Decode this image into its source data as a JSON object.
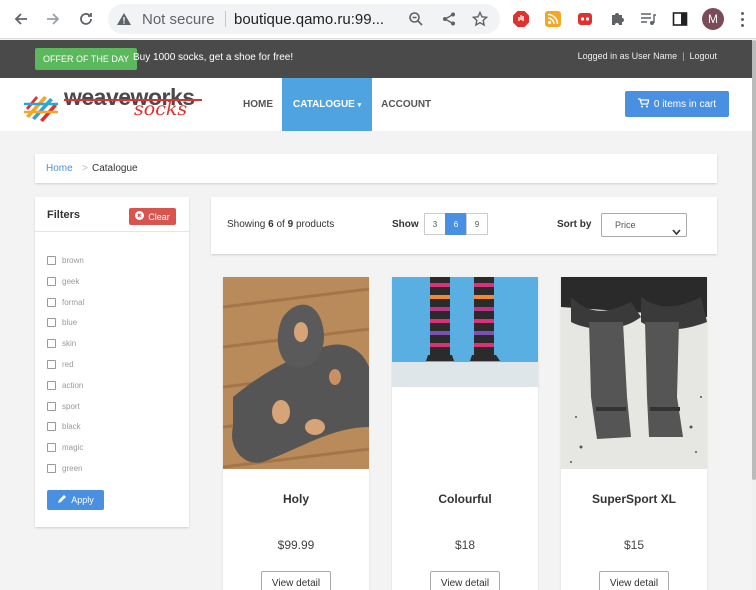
{
  "browser": {
    "security_label": "Not secure",
    "url": "boutique.qamo.ru:99...",
    "profile_initial": "M"
  },
  "topbar": {
    "offer_badge": "OFFER OF THE DAY",
    "offer_text": "Buy 1000 socks, get a shoe for free!",
    "logged_in": "Logged in as User Name",
    "logout": "Logout"
  },
  "header": {
    "logo_main": "weaveworks",
    "logo_sub": "socks",
    "nav": [
      "HOME",
      "CATALOGUE",
      "ACCOUNT"
    ],
    "cart_label": "0 items in cart"
  },
  "breadcrumb": {
    "home": "Home",
    "separator": ">",
    "current": "Catalogue"
  },
  "filters": {
    "title": "Filters",
    "clear_label": "Clear",
    "items": [
      "brown",
      "geek",
      "formal",
      "blue",
      "skin",
      "red",
      "action",
      "sport",
      "black",
      "magic",
      "green"
    ],
    "apply_label": "Apply"
  },
  "toolbar": {
    "showing_prefix": "Showing",
    "showing_count": "6",
    "showing_of": "of",
    "showing_total": "9",
    "showing_suffix": "products",
    "show_label": "Show",
    "page_sizes": [
      "3",
      "6",
      "9"
    ],
    "active_page_size": "6",
    "sort_label": "Sort by",
    "sort_value": "Price"
  },
  "products": [
    {
      "name": "Holy",
      "price": "$99.99",
      "button": "View detail"
    },
    {
      "name": "Colourful",
      "price": "$18",
      "button": "View detail"
    },
    {
      "name": "SuperSport XL",
      "price": "$15",
      "button": "View detail"
    }
  ],
  "colors": {
    "accent": "#4a90e2",
    "success": "#5cb85c",
    "danger": "#d9534f",
    "topbar": "#4a4a4a"
  }
}
